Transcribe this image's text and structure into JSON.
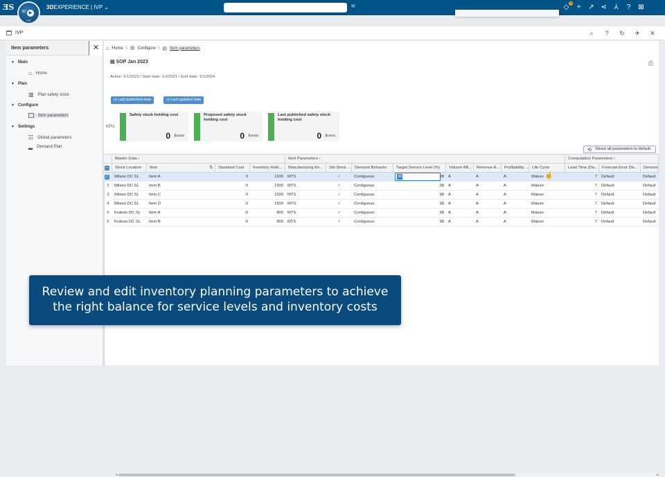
{
  "topbar": {
    "logo": "ƎS",
    "compass": {
      "left": "3D",
      "right": "V,R"
    },
    "brand_bold": "3D",
    "brand_rest": "EXPERIENCE | IVP",
    "notification_count": "3"
  },
  "app": {
    "title": "IVP"
  },
  "sidebar": {
    "title": "Item parameters",
    "sections": [
      {
        "label": "Main",
        "items": [
          {
            "label": "Home"
          }
        ]
      },
      {
        "label": "Plan",
        "items": [
          {
            "label": "Plan safety stock"
          }
        ]
      },
      {
        "label": "Configure",
        "items": [
          {
            "label": "Item parameters"
          }
        ]
      },
      {
        "label": "Settings",
        "items": [
          {
            "label": "Global parameters"
          },
          {
            "label": "Demand Plan"
          }
        ]
      }
    ]
  },
  "breadcrumb": {
    "home": "Home",
    "configure": "Configure",
    "current": "Item parameters"
  },
  "scenario": {
    "name": "SOP Jan 2023",
    "dates": "Active: 1/1/2023 / Start date: 1/1/2021 / End date: 1/1/2024"
  },
  "filters": {
    "last_published": "Last published date",
    "last_updated": "Last updated date"
  },
  "kpis": {
    "label": "KPIs",
    "cards": [
      {
        "title": "Safety stock holding cost",
        "value": "0",
        "unit": "Euros"
      },
      {
        "title": "Proposed safety stock holding cost",
        "value": "0",
        "unit": "Euros"
      },
      {
        "title": "Last published safety stock holding cost",
        "value": "0",
        "unit": "Euros"
      }
    ]
  },
  "reset_button": "Reset all parameters to default",
  "grid": {
    "groups": {
      "master": "Master Data",
      "item": "Item Parameters",
      "computation": "Computation Parameters"
    },
    "columns": [
      "Stock Location",
      "Item",
      "Standard Cost",
      "Inventory Hold...",
      "Manufacturing En...",
      "Set Stock ...",
      "Demand Behavior",
      "Target Service Level (%)",
      "Volume AB...",
      "Revenue A...",
      "Profitability ...",
      "Life Cycle",
      "Lead Time (Da...",
      "Forecast Error Dis...",
      "Demand"
    ],
    "rows": [
      {
        "n": "1",
        "loc": "Milano DC SL",
        "item": "Item A",
        "cost": "0",
        "hold": "1500",
        "mfg": "MTS",
        "set": "✓",
        "demand": "Contiguous",
        "tsl": "98",
        "vol": "A",
        "rev": "A",
        "prof": "A",
        "life": "Mature",
        "lead": "7",
        "fed": "Default",
        "dem": "Default"
      },
      {
        "n": "2",
        "loc": "Milano DC SL",
        "item": "Item B",
        "cost": "0",
        "hold": "1500",
        "mfg": "MTS",
        "set": "✓",
        "demand": "Contiguous",
        "tsl": "98",
        "vol": "A",
        "rev": "A",
        "prof": "A",
        "life": "Mature",
        "lead": "7",
        "fed": "Default",
        "dem": "Default"
      },
      {
        "n": "3",
        "loc": "Milano DC SL",
        "item": "Item C",
        "cost": "0",
        "hold": "1500",
        "mfg": "MTS",
        "set": "✓",
        "demand": "Contiguous",
        "tsl": "98",
        "vol": "A",
        "rev": "A",
        "prof": "A",
        "life": "Mature",
        "lead": "7",
        "fed": "Default",
        "dem": "Default"
      },
      {
        "n": "4",
        "loc": "Milano DC SL",
        "item": "Item D",
        "cost": "0",
        "hold": "1500",
        "mfg": "MTS",
        "set": "✓",
        "demand": "Contiguous",
        "tsl": "98",
        "vol": "A",
        "rev": "A",
        "prof": "A",
        "life": "Mature",
        "lead": "7",
        "fed": "Default",
        "dem": "Default"
      },
      {
        "n": "5",
        "loc": "Krakow DC SL",
        "item": "Item A",
        "cost": "0",
        "hold": "800",
        "mfg": "MTS",
        "set": "✓",
        "demand": "Contiguous",
        "tsl": "98",
        "vol": "A",
        "rev": "A",
        "prof": "A",
        "life": "Mature",
        "lead": "7",
        "fed": "Default",
        "dem": "Default"
      },
      {
        "n": "6",
        "loc": "Krakow DC SL",
        "item": "Item B",
        "cost": "0",
        "hold": "800",
        "mfg": "MTS",
        "set": "✓",
        "demand": "Contiguous",
        "tsl": "98",
        "vol": "A",
        "rev": "A",
        "prof": "A",
        "life": "Mature",
        "lead": "7",
        "fed": "Default",
        "dem": "Default"
      }
    ],
    "selected_row": 1
  },
  "caption": {
    "line1": "Review and edit inventory planning parameters to achieve",
    "line2": "the right balance for service levels and inventory costs"
  },
  "colors": {
    "topbar": "#005386",
    "accent": "#4a8fd0",
    "kpi_bar": "#4caf50",
    "caption_bg": "#0b4a7c"
  }
}
